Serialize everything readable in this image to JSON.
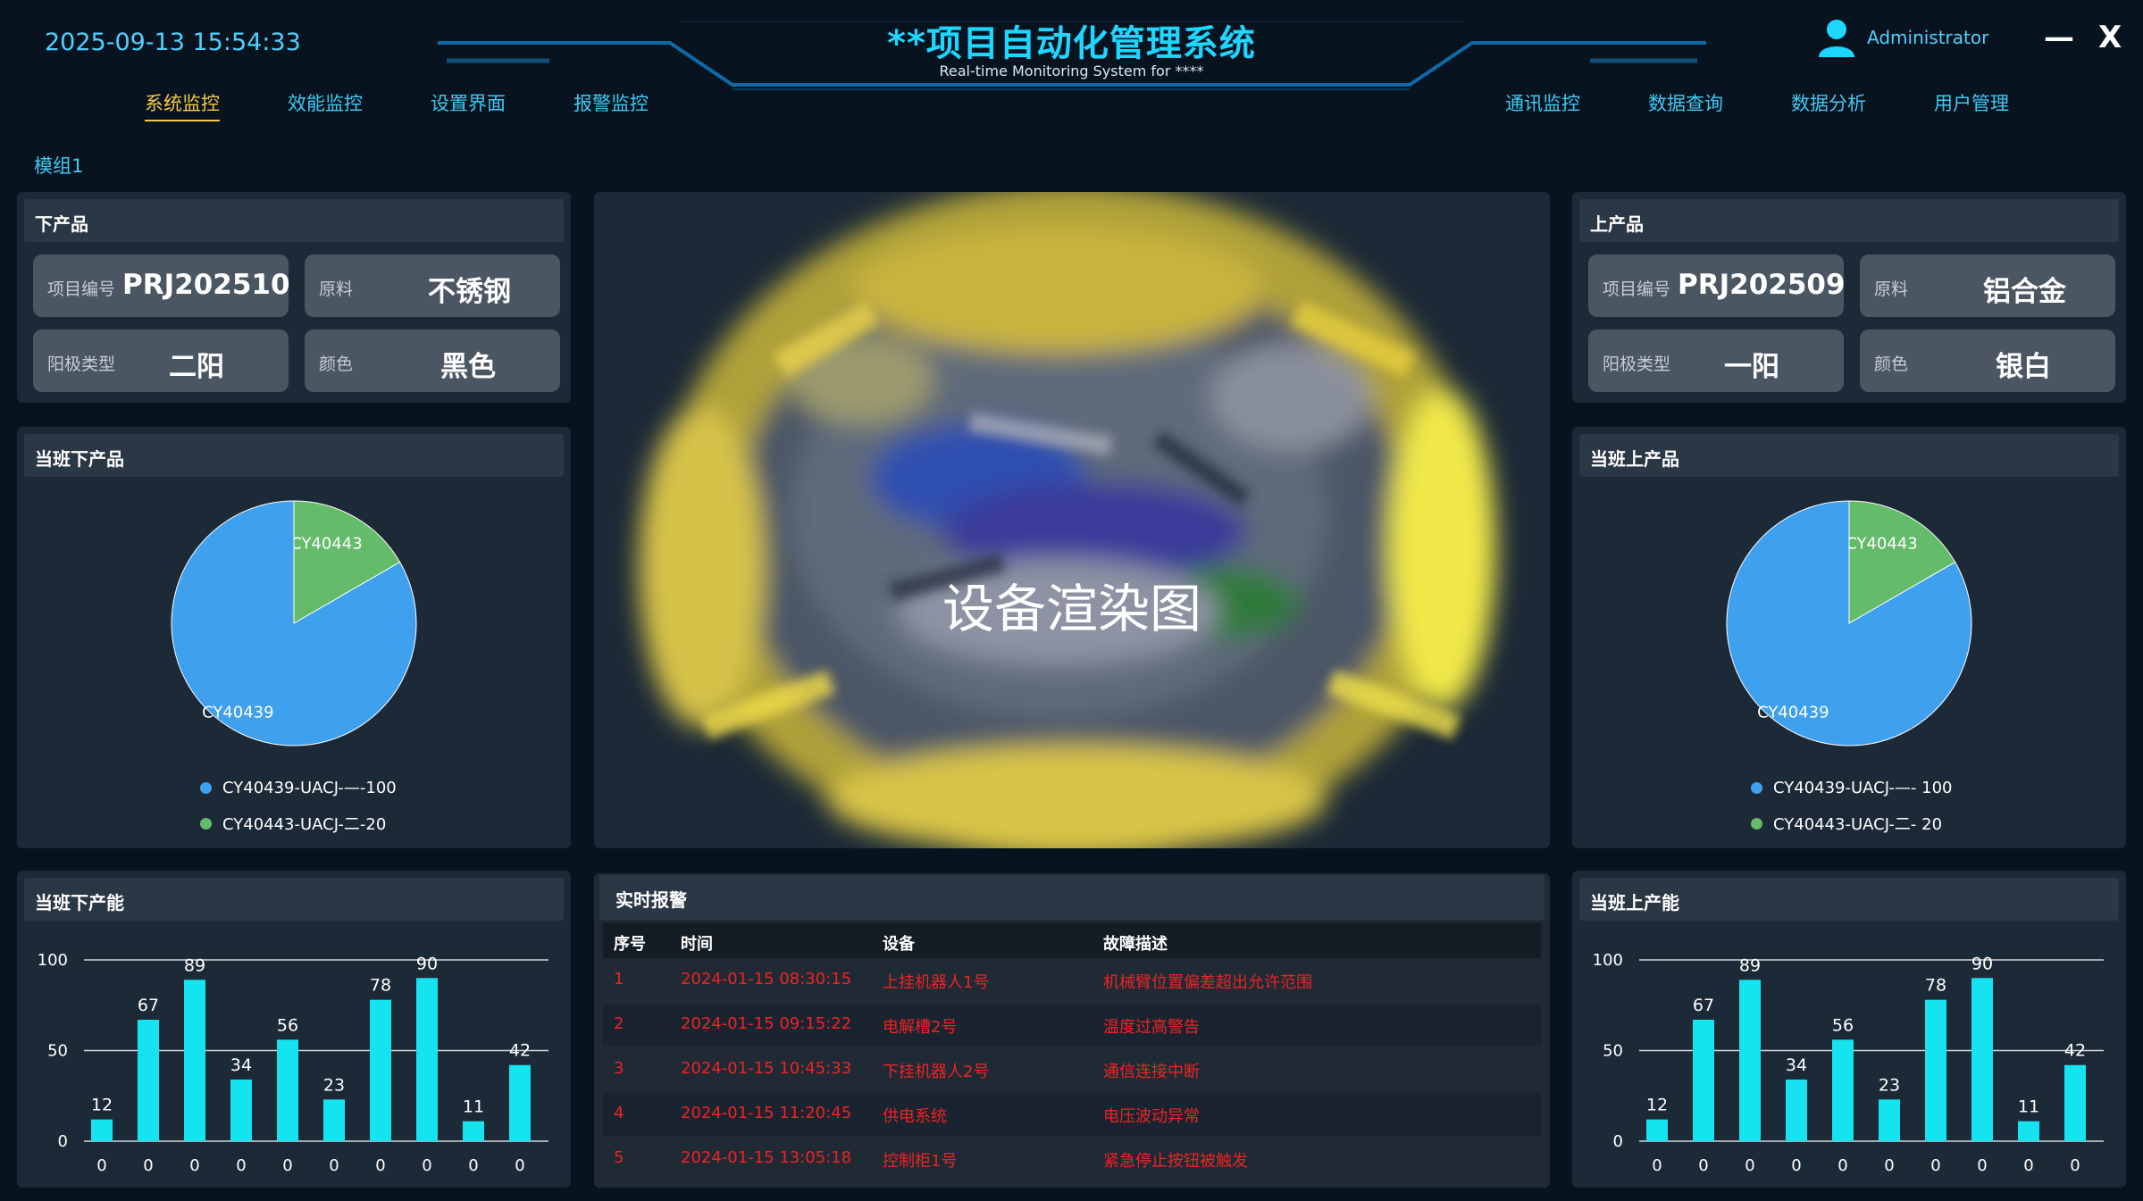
{
  "header": {
    "datetime": "2025-09-13 15:54:33",
    "title": "**项目自动化管理系统",
    "subtitle": "Real-time Monitoring System for ****",
    "user": "Administrator",
    "minimize": "—",
    "close": "X",
    "nav_left": [
      "系统监控",
      "效能监控",
      "设置界面",
      "报警监控"
    ],
    "nav_right": [
      "通讯监控",
      "数据查询",
      "数据分析",
      "用户管理"
    ],
    "active_nav": "系统监控"
  },
  "module": "模组1",
  "down_product": {
    "title": "下产品",
    "project_no_label": "项目编号",
    "project_no": "PRJ202510",
    "material_label": "原料",
    "material": "不锈钢",
    "anode_label": "阳极类型",
    "anode": "二阳",
    "color_label": "颜色",
    "color": "黑色"
  },
  "up_product": {
    "title": "上产品",
    "project_no_label": "项目编号",
    "project_no": "PRJ202509",
    "material_label": "原料",
    "material": "铝合金",
    "anode_label": "阳极类型",
    "anode": "一阳",
    "color_label": "颜色",
    "color": "银白"
  },
  "center": {
    "render_label": "设备渲染图"
  },
  "shift_down_products": {
    "title": "当班下产品",
    "chart_data": {
      "type": "pie",
      "slices": [
        {
          "label": "CY40439",
          "value": 100,
          "color": "#3fa0ee"
        },
        {
          "label": "CY40443",
          "value": 20,
          "color": "#64bb6a"
        }
      ],
      "legend": [
        "CY40439-UACJ-—-100",
        "CY40443-UACJ-二-20"
      ]
    }
  },
  "shift_up_products": {
    "title": "当班上产品",
    "chart_data": {
      "type": "pie",
      "slices": [
        {
          "label": "CY40439",
          "value": 100,
          "color": "#3fa0ee"
        },
        {
          "label": "CY40443",
          "value": 20,
          "color": "#64bb6a"
        }
      ],
      "legend": [
        "CY40439-UACJ-—- 100",
        "CY40443-UACJ-二- 20"
      ]
    }
  },
  "shift_down_capacity": {
    "title": "当班下产能",
    "chart_data": {
      "type": "bar",
      "categories": [
        "0",
        "0",
        "0",
        "0",
        "0",
        "0",
        "0",
        "0",
        "0",
        "0"
      ],
      "values": [
        12,
        67,
        89,
        34,
        56,
        23,
        78,
        90,
        11,
        42
      ],
      "ylim": [
        0,
        100
      ],
      "yticks": [
        0,
        50,
        100
      ],
      "color": "#16e3f0"
    }
  },
  "shift_up_capacity": {
    "title": "当班上产能",
    "chart_data": {
      "type": "bar",
      "categories": [
        "0",
        "0",
        "0",
        "0",
        "0",
        "0",
        "0",
        "0",
        "0",
        "0"
      ],
      "values": [
        12,
        67,
        89,
        34,
        56,
        23,
        78,
        90,
        11,
        42
      ],
      "ylim": [
        0,
        100
      ],
      "yticks": [
        0,
        50,
        100
      ],
      "color": "#16e3f0"
    }
  },
  "alarms": {
    "title": "实时报警",
    "columns": [
      "序号",
      "时间",
      "设备",
      "故障描述"
    ],
    "rows": [
      [
        "1",
        "2024-01-15 08:30:15",
        "上挂机器人1号",
        "机械臂位置偏差超出允许范围"
      ],
      [
        "2",
        "2024-01-15 09:15:22",
        "电解槽2号",
        "温度过高警告"
      ],
      [
        "3",
        "2024-01-15 10:45:33",
        "下挂机器人2号",
        "通信连接中断"
      ],
      [
        "4",
        "2024-01-15 11:20:45",
        "供电系统",
        "电压波动异常"
      ],
      [
        "5",
        "2024-01-15 13:05:18",
        "控制柜1号",
        "紧急停止按钮被触发"
      ]
    ]
  },
  "colors": {
    "accent": "#1ed6ff",
    "alarm": "#ee2323",
    "bar": "#16e3f0",
    "active": "#f5c84a"
  }
}
